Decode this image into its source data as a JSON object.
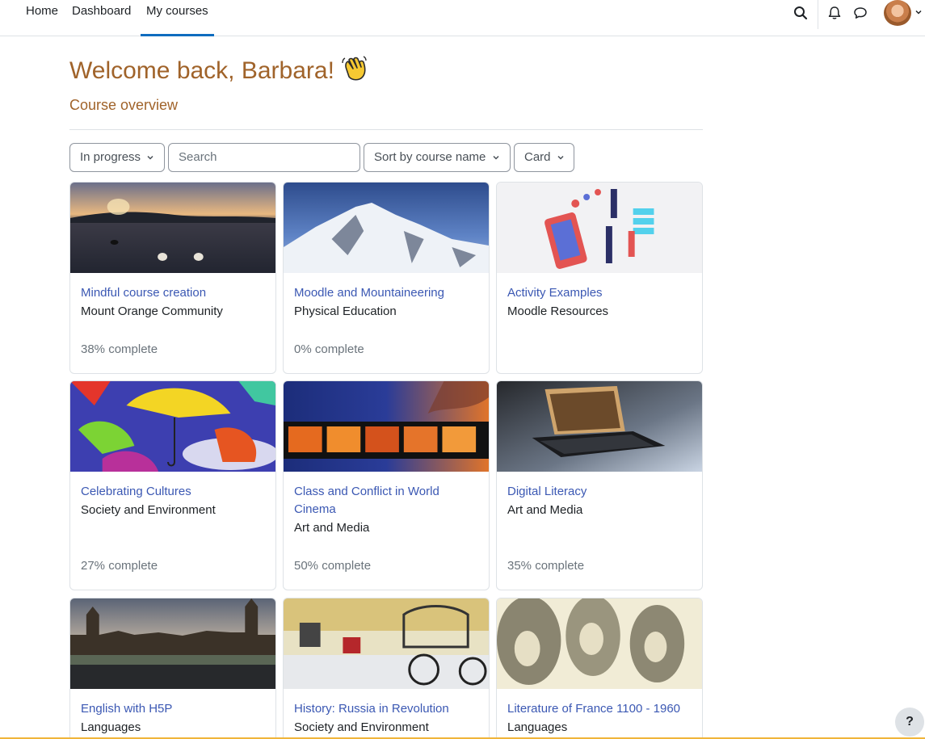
{
  "navbar": {
    "items": [
      {
        "label": "Home"
      },
      {
        "label": "Dashboard"
      },
      {
        "label": "My courses"
      }
    ],
    "active_item": "My courses",
    "icons": [
      "search-icon",
      "bell-icon",
      "chat-icon",
      "avatar",
      "chevron-down-icon"
    ]
  },
  "page": {
    "welcome": "Welcome back, Barbara!",
    "wave_icon": "waving-hand-icon",
    "section_title": "Course overview"
  },
  "filters": {
    "grouping": "In progress",
    "search_placeholder": "Search",
    "sort": "Sort by course name",
    "view": "Card"
  },
  "courses": [
    {
      "name": "Mindful course creation",
      "category": "Mount Orange Community",
      "progress": "38% complete"
    },
    {
      "name": "Moodle and Mountaineering",
      "category": "Physical Education",
      "progress": "0% complete"
    },
    {
      "name": "Activity Examples",
      "category": "Moodle Resources",
      "progress": ""
    },
    {
      "name": "Celebrating Cultures",
      "category": "Society and Environment",
      "progress": "27% complete"
    },
    {
      "name": "Class and Conflict in World Cinema",
      "category": "Art and Media",
      "progress": "50% complete"
    },
    {
      "name": "Digital Literacy",
      "category": "Art and Media",
      "progress": "35% complete"
    },
    {
      "name": "English with H5P",
      "category": "Languages",
      "progress": ""
    },
    {
      "name": "History: Russia in Revolution",
      "category": "Society and Environment",
      "progress": ""
    },
    {
      "name": "Literature of France 1100 - 1960",
      "category": "Languages",
      "progress": ""
    }
  ],
  "help": {
    "label": "?"
  },
  "colors": {
    "heading": "#a0632a",
    "link": "#3b58b3",
    "active_tab": "#0f6cbf"
  }
}
